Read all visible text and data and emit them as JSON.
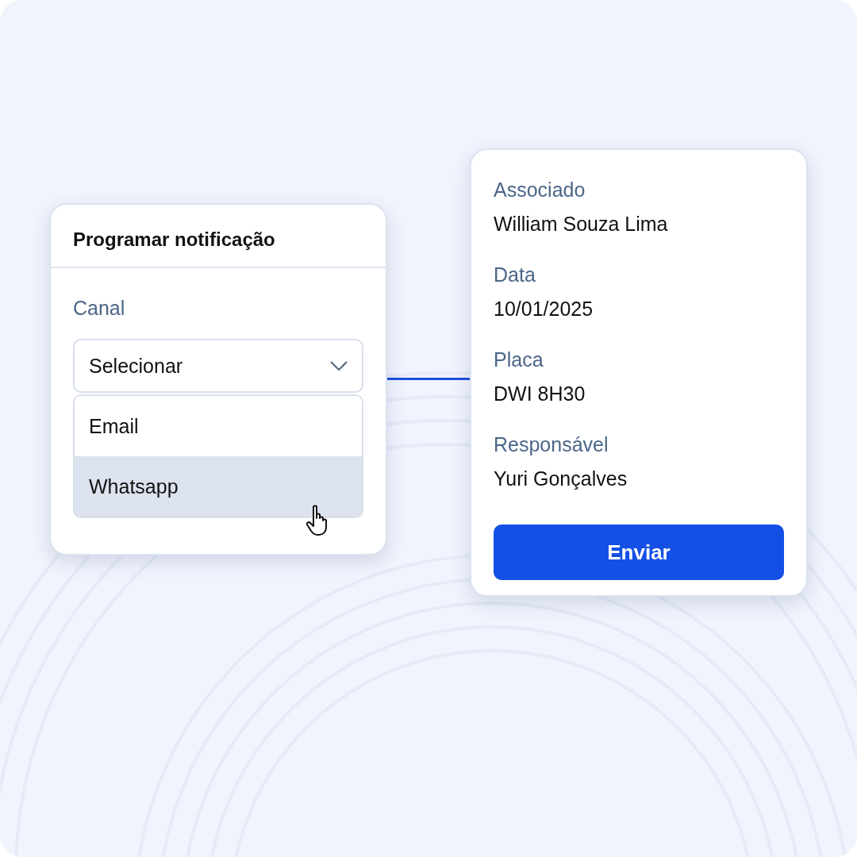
{
  "notification_card": {
    "title": "Programar notificação",
    "field_label": "Canal",
    "select": {
      "placeholder": "Selecionar"
    },
    "options": [
      {
        "label": "Email",
        "selected": false
      },
      {
        "label": "Whatsapp",
        "selected": true
      }
    ]
  },
  "details_card": {
    "fields": [
      {
        "label": "Associado",
        "value": "William Souza Lima"
      },
      {
        "label": "Data",
        "value": "10/01/2025"
      },
      {
        "label": "Placa",
        "value": "DWI 8H30"
      },
      {
        "label": "Responsável",
        "value": "Yuri Gonçalves"
      }
    ],
    "button": "Enviar"
  }
}
